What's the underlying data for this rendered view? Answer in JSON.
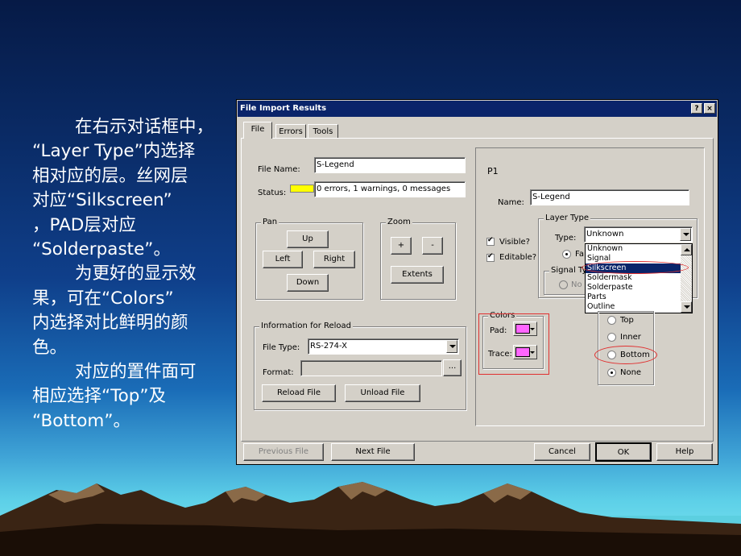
{
  "slide": {
    "text": {
      "p1_line1": "在右示对话框中，",
      "p1_line2": "“Layer Type”内选择",
      "p1_line3": "相对应的层。丝网层",
      "p1_line4": "对应“Silkscreen”",
      "p1_line5": "，PAD层对应",
      "p1_line6": "“Solderpaste”。",
      "p2_line1": "为更好的显示效",
      "p2_line2": "果，可在“Colors”",
      "p2_line3": "内选择对比鲜明的颜",
      "p2_line4": "色。",
      "p3_line1": "对应的置件面可",
      "p3_line2": "相应选择“Top”及",
      "p3_line3": "“Bottom”。"
    }
  },
  "dialog": {
    "title": "File Import Results",
    "help_btn": "?",
    "close_btn": "×",
    "tabs": [
      "File",
      "Errors",
      "Tools"
    ],
    "file_name_label": "File Name:",
    "file_name_value": "S-Legend",
    "status_label": "Status:",
    "status_value": "0 errors, 1 warnings, 0 messages",
    "status_color": "#ffff00",
    "pan": {
      "label": "Pan",
      "up": "Up",
      "left": "Left",
      "right": "Right",
      "down": "Down"
    },
    "zoom": {
      "label": "Zoom",
      "plus": "+",
      "minus": "-",
      "extents": "Extents"
    },
    "reload": {
      "label": "Information for Reload",
      "file_type_label": "File Type:",
      "file_type_value": "RS-274-X",
      "format_label": "Format:",
      "browse": "...",
      "reload_btn": "Reload File",
      "unload_btn": "Unload File"
    },
    "layer": {
      "id": "P1",
      "name_label": "Name:",
      "name_value": "S-Legend",
      "visible_label": "Visible?",
      "editable_label": "Editable?",
      "layer_type_label": "Layer Type",
      "type_label": "Type:",
      "type_value": "Unknown",
      "type_options": [
        "Unknown",
        "Signal",
        "Silkscreen",
        "Soldermask",
        "Solderpaste",
        "Parts",
        "Outline"
      ],
      "selected_option": "Silkscreen",
      "fa_label": "Fa",
      "signal_type_label": "Signal Ty",
      "no_label": "No"
    },
    "colors": {
      "label": "Colors",
      "pad_label": "Pad:",
      "trace_label": "Trace:",
      "pad_color": "#ff66ff",
      "trace_color": "#ff66ff"
    },
    "side": {
      "top": "Top",
      "inner": "Inner",
      "bottom": "Bottom",
      "none": "None"
    },
    "footer": {
      "previous": "Previous File",
      "next": "Next File",
      "cancel": "Cancel",
      "ok": "OK",
      "help": "Help"
    },
    "highlight_color": "#e03030"
  }
}
